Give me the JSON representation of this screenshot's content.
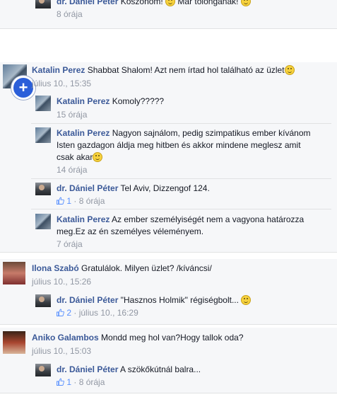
{
  "top": {
    "author": "dr. Dániel Péter",
    "text_a": "Köszönöm! ",
    "text_b": " Már tolonganak! ",
    "time": "8 órája"
  },
  "threads": [
    {
      "author": "Katalin Perez",
      "text": "Shabbat Shalom! Azt nem írtad hol található az üzlet",
      "time": "július 10., 15:35",
      "replies": [
        {
          "author": "Katalin Perez",
          "text": "Komoly?????",
          "time": "15 órája"
        },
        {
          "author": "Katalin Perez",
          "line1": "Nagyon sajnálom, pedig szimpatikus ember kívánom",
          "line2": "Isten gazdagon áldja meg hitben és akkor mindene meglesz amit",
          "line3": "csak akar",
          "time": "14 órája"
        },
        {
          "author": "dr. Dániel Péter",
          "text": "Tel Aviv, Dizzengof 124.",
          "likes": "1",
          "time": "8 órája"
        },
        {
          "author": "Katalin Perez",
          "line1": "Az ember személyiségét nem a vagyona határozza",
          "line2": "meg.Ez az én személyes véleményem.",
          "time": "7 órája"
        }
      ]
    },
    {
      "author": "Ilona Szabó",
      "text": "Gratulálok. Milyen üzlet? /kíváncsi/",
      "time": "július 10., 15:26",
      "replies": [
        {
          "author": "dr. Dániel Péter",
          "text": "\"Hasznos Holmik\" régiségbolt... ",
          "likes": "2",
          "time": "július 10., 16:29"
        }
      ]
    },
    {
      "author": "Aniko Galambos",
      "text": "Mondd meg hol van?Hogy tallok oda?",
      "time": "július 10., 15:03",
      "replies": [
        {
          "author": "dr. Dániel Péter",
          "text": "A szökőkútnál balra...",
          "likes": "1",
          "time": "8 órája"
        }
      ]
    }
  ],
  "ui": {
    "zoom_symbol": "+",
    "dot": " · "
  },
  "colors": {
    "name": "#3b5998",
    "meta": "#9197a3",
    "bg": "#f6f7f9"
  }
}
